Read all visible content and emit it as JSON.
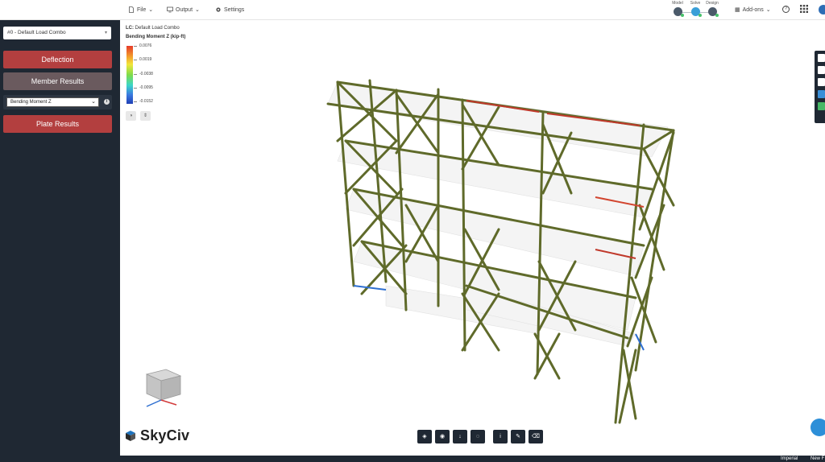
{
  "topbar": {
    "menus": [
      {
        "label": "File",
        "icon": "file-icon"
      },
      {
        "label": "Output",
        "icon": "monitor-icon"
      },
      {
        "label": "Settings",
        "icon": "gear-icon"
      }
    ],
    "stages": [
      "Model",
      "Solve",
      "Design"
    ],
    "addons_label": "Add-ons"
  },
  "sidebar": {
    "load_combo": "#0 - Default Load Combo",
    "deflection_label": "Deflection",
    "member_results_label": "Member Results",
    "result_type": "Bending Moment Z",
    "plate_results_label": "Plate Results"
  },
  "canvas": {
    "lc_prefix": "LC:",
    "lc_name": "Default Load Combo",
    "legend_title": "Bending Moment Z (kip-ft)",
    "legend_values": [
      "0.0076",
      "0.0019",
      "-0.0038",
      "-0.0095",
      "-0.0152"
    ],
    "logo_text": "SkyCiv"
  },
  "statusbar": {
    "units": "Imperial",
    "new_label": "New F"
  },
  "colors": {
    "sidebar_bg": "#1f2833",
    "accent_red": "#b33f3f",
    "member_olive": "#5f6a2a"
  }
}
